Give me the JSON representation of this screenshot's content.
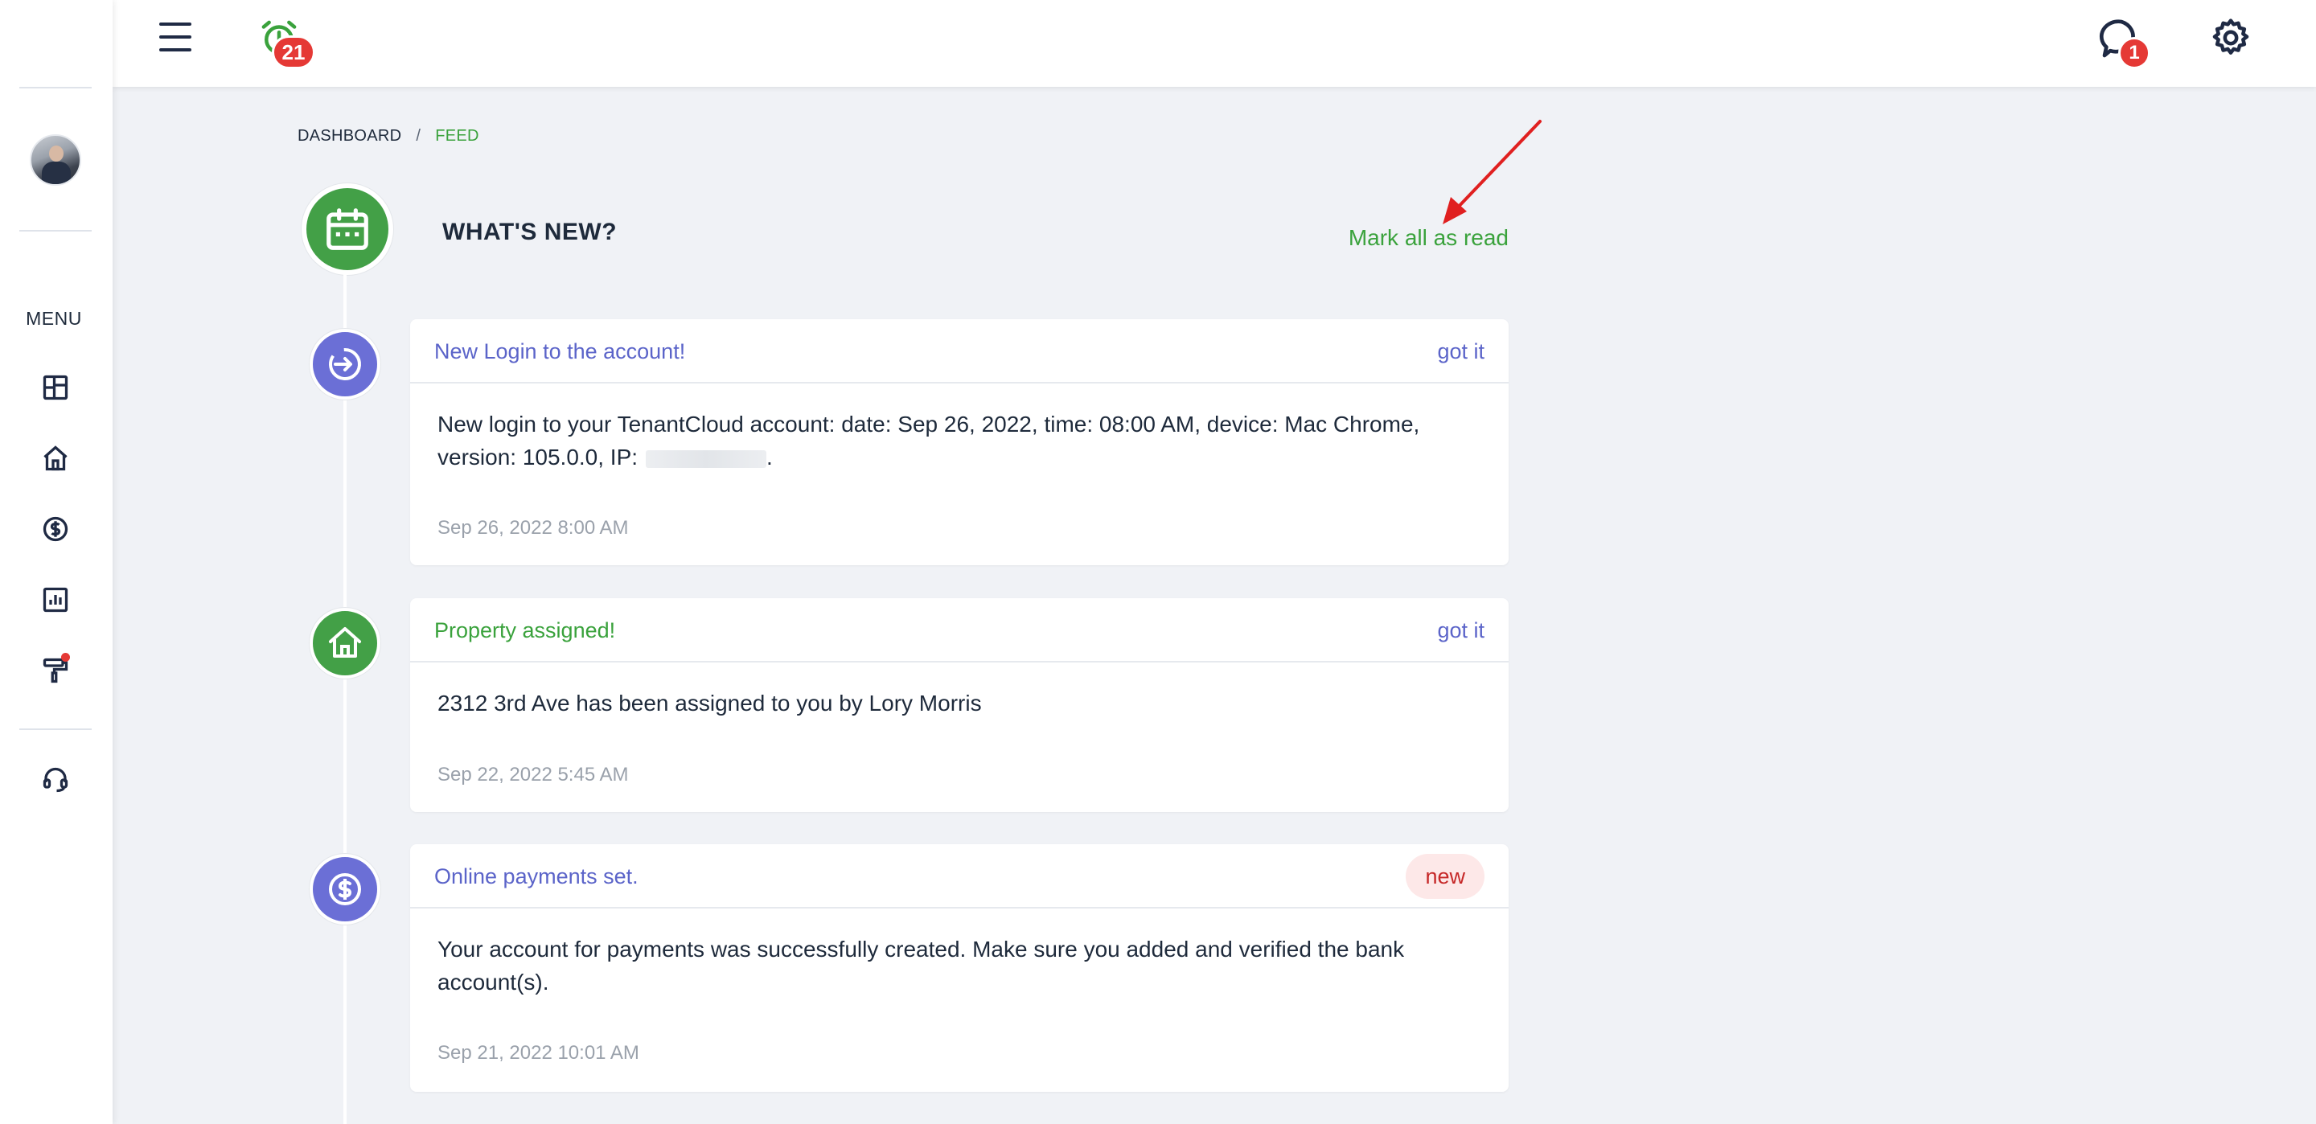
{
  "topbar": {
    "alarm_badge": "21",
    "chat_badge": "1"
  },
  "sidebar": {
    "menu_label": "MENU",
    "items": [
      {
        "icon": "dashboard-icon"
      },
      {
        "icon": "home-icon"
      },
      {
        "icon": "dollar-icon"
      },
      {
        "icon": "chart-icon"
      },
      {
        "icon": "paint-roller-icon",
        "has_notification_dot": true
      },
      {
        "icon": "headset-icon"
      }
    ]
  },
  "breadcrumb": {
    "items": [
      "DASHBOARD",
      "FEED"
    ],
    "separator": "/"
  },
  "page": {
    "title": "WHAT'S NEW?",
    "mark_all_label": "Mark all as read"
  },
  "feed": [
    {
      "title": "New Login to the account!",
      "action": "got it",
      "body_prefix": "New login to your TenantCloud account: date: Sep 26, 2022, time: 08:00 AM, device: Mac Chrome, version: 105.0.0, IP:",
      "body_suffix": ".",
      "date": "Sep 26, 2022 8:00 AM",
      "icon": "login-icon"
    },
    {
      "title": "Property assigned!",
      "action": "got it",
      "body": "2312 3rd Ave has been assigned to you by Lory Morris",
      "date": "Sep 22, 2022 5:45 AM",
      "icon": "home-icon"
    },
    {
      "title": "Online payments set.",
      "tag": "new",
      "body": "Your account for payments was successfully created. Make sure you added and verified the bank account(s).",
      "date": "Sep 21, 2022 10:01 AM",
      "icon": "dollar-icon"
    }
  ],
  "colors": {
    "accent_green": "#3aa23c",
    "accent_purple": "#5b64c9",
    "badge_red": "#e53935",
    "background": "#f0f2f6"
  }
}
